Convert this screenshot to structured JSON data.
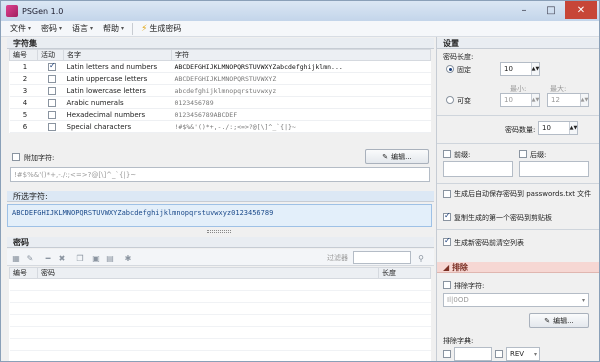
{
  "window": {
    "title": "PSGen 1.0",
    "min": "–",
    "max": "□",
    "close": "✕"
  },
  "menu": {
    "file": "文件",
    "password": "密码",
    "language": "语言",
    "help": "帮助",
    "generate": "生成密码"
  },
  "charset": {
    "section": "字符集",
    "columns": [
      "编号",
      "活动",
      "名字",
      "字符"
    ],
    "rows": [
      {
        "num": "1",
        "active": true,
        "name": "Latin letters and numbers",
        "chars": "ABCDEFGHIJKLMNOPQRSTUVWXYZabcdefghijklmn...",
        "selected": true
      },
      {
        "num": "2",
        "active": false,
        "name": "Latin uppercase letters",
        "chars": "ABCDEFGHIJKLMNOPQRSTUVWXYZ"
      },
      {
        "num": "3",
        "active": false,
        "name": "Latin lowercase letters",
        "chars": "abcdefghijklmnopqrstuvwxyz"
      },
      {
        "num": "4",
        "active": false,
        "name": "Arabic numerals",
        "chars": "0123456789"
      },
      {
        "num": "5",
        "active": false,
        "name": "Hexadecimal numbers",
        "chars": "0123456789ABCDEF"
      },
      {
        "num": "6",
        "active": false,
        "name": "Special characters",
        "chars": "!#$%&'()*+,-./:;<=>?@[\\]^_`{|}~"
      }
    ],
    "extra_label": "附加字符:",
    "edit_button": "编辑...",
    "extra_value": "!#$%&'()*+,-./:;<=>?@[\\]^_`{|}~"
  },
  "selected": {
    "label": "所选字符:",
    "value": "ABCDEFGHIJKLMNOPQRSTUVWXYZabcdefghijklmnopqrstuvwxyz0123456789"
  },
  "passwords": {
    "section": "密码",
    "filter_label": "过滤器",
    "columns": [
      "编号",
      "密码",
      "长度"
    ]
  },
  "settings": {
    "section": "设置",
    "length_label": "密码长度:",
    "fixed_label": "固定",
    "fixed_value": "10",
    "variable_label": "可变",
    "min_label": "最小:",
    "min_value": "10",
    "max_label": "最大:",
    "max_value": "12",
    "count_label": "密码数量:",
    "count_value": "10",
    "prefix_label": "前缀:",
    "suffix_label": "后缀:",
    "autosave_label": "生成后自动保存密码到 passwords.txt 文件",
    "copy_label": "复制生成的第一个密码到剪贴板",
    "clear_label": "生成新密码前清空列表"
  },
  "exclude": {
    "section": "排除",
    "chars_label": "排除字符:",
    "chars_value": "Il|0OD",
    "edit_button": "编辑...",
    "dict_label": "排除字典:",
    "rev_value": "REV"
  }
}
